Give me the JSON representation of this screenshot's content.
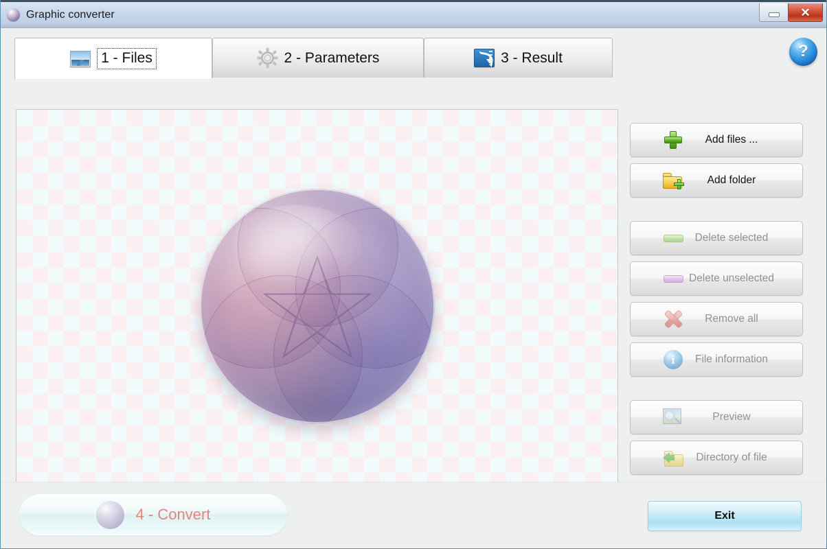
{
  "window": {
    "title": "Graphic converter",
    "title_icon": "app-orb-icon",
    "minimize_label": "",
    "close_label": "✕"
  },
  "help": {
    "label": "?",
    "icon": "help-icon"
  },
  "tabs": [
    {
      "label": "1 - Files",
      "icon": "photo-icon",
      "active": true
    },
    {
      "label": "2 - Parameters",
      "icon": "gear-icon",
      "active": false
    },
    {
      "label": "3 - Result",
      "icon": "result-icon",
      "active": false
    }
  ],
  "file_list": {
    "items": [],
    "preview_icon": "sphere-star-thumbnail"
  },
  "sidebar": {
    "groups": [
      {
        "buttons": [
          {
            "label": "Add files ...",
            "icon": "green-plus-icon",
            "enabled": true
          },
          {
            "label": "Add folder",
            "icon": "folder-plus-icon",
            "enabled": true
          }
        ]
      },
      {
        "buttons": [
          {
            "label": "Delete selected",
            "icon": "green-bar-icon",
            "enabled": false
          },
          {
            "label": "Delete unselected",
            "icon": "purple-bar-icon",
            "enabled": false
          },
          {
            "label": "Remove all",
            "icon": "red-x-icon",
            "enabled": false
          },
          {
            "label": "File information",
            "icon": "info-icon",
            "enabled": false
          }
        ]
      },
      {
        "buttons": [
          {
            "label": "Preview",
            "icon": "magnifier-image-icon",
            "enabled": false
          },
          {
            "label": "Directory of file",
            "icon": "folder-arrow-icon",
            "enabled": false
          }
        ]
      }
    ]
  },
  "footer": {
    "convert_label": "4 - Convert",
    "convert_icon": "sphere-icon",
    "exit_label": "Exit"
  },
  "colors": {
    "titlebar": "#c6d7ea",
    "close_button": "#cf4a28",
    "convert_text": "#e2685f",
    "exit_button": "#c5e8f6",
    "accent_blue": "#2b8fe0",
    "checker_pink": "#fbeff1",
    "checker_mint": "#f2fbfb"
  }
}
